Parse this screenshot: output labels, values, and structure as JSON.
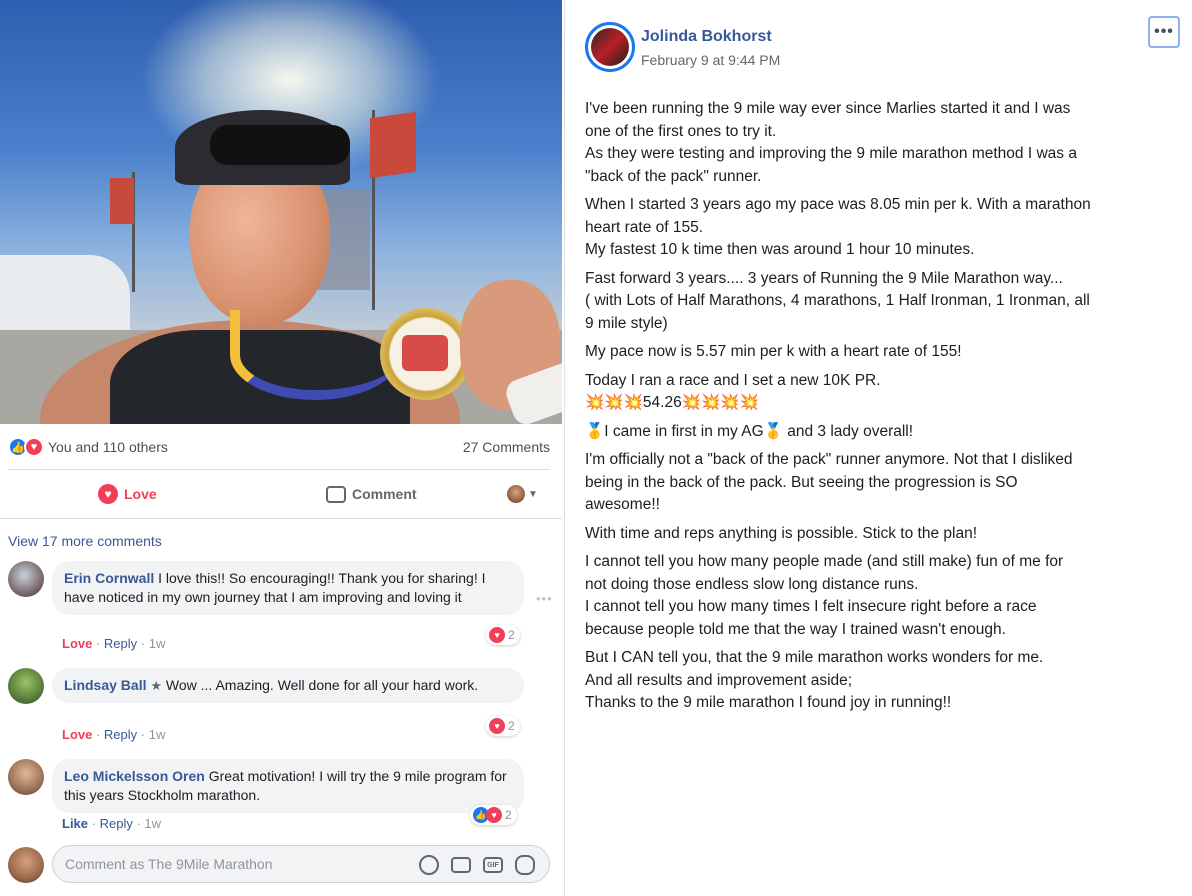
{
  "post": {
    "author": "Jolinda Bokhorst",
    "timestamp": "February 9 at 9:44 PM",
    "more_label": "•••",
    "paragraphs": [
      "I've been running the 9 mile way ever since Marlies started it and I was\none of the first ones to try it.\nAs they were testing and improving the 9 mile marathon method I was a\n\"back of the pack\" runner.",
      "When I started 3 years ago my pace was 8.05 min per k. With a marathon\nheart rate of 155.\nMy fastest 10 k time then was around 1 hour 10 minutes.",
      "Fast forward 3 years.... 3 years of Running the 9 Mile Marathon way...\n( with Lots of Half Marathons, 4 marathons, 1 Half Ironman, 1 Ironman, all\n9 mile style)",
      "My pace now is 5.57 min per k with a heart rate of 155!",
      "Today I ran a race and I set a new 10K PR.\n💥💥💥54.26💥💥💥💥",
      "🥇I came in first in my AG🥇 and 3 lady overall!",
      "I'm officially not a \"back of the pack\" runner anymore. Not that I disliked\nbeing in the back of the pack. But seeing the progression is SO\nawesome!!",
      "With time and reps anything is possible. Stick to the plan!",
      "I cannot tell you how many people made (and still make) fun of me for\nnot doing those endless slow long distance runs.\nI cannot tell you how many times I felt insecure right before a race\nbecause people told me that the way I trained wasn't enough.",
      "But I CAN tell you, that the 9 mile marathon works wonders for me.\nAnd all results and improvement aside;\nThanks to the 9 mile marathon I found joy in running!!"
    ]
  },
  "stats": {
    "reactions_text": "You and 110 others",
    "comments_count": "27 Comments"
  },
  "actions": {
    "love_label": "Love",
    "comment_label": "Comment"
  },
  "comments_section": {
    "view_more": "View 17 more comments",
    "comments": [
      {
        "name": "Erin Cornwall",
        "text": "I love this!! So encouraging!! Thank you for sharing! I have noticed in my own journey that I am improving and loving it",
        "reaction_label": "Love",
        "reply_label": "Reply",
        "age": "1w",
        "reaction_count": "2"
      },
      {
        "name": "Lindsay Ball",
        "text": "Wow ... Amazing. Well done for all your hard work.",
        "reaction_label": "Love",
        "reply_label": "Reply",
        "age": "1w",
        "reaction_count": "2"
      },
      {
        "name": "Leo Mickelsson Oren",
        "text": "Great motivation! I will try the 9 mile program for this years Stockholm marathon.",
        "reaction_label": "Like",
        "reply_label": "Reply",
        "age": "1w",
        "reaction_count": "2"
      }
    ],
    "compose_placeholder": "Comment as The 9Mile Marathon",
    "gif_label": "GIF"
  },
  "colors": {
    "link": "#385898",
    "love": "#f33e58",
    "like": "#1877f2"
  }
}
